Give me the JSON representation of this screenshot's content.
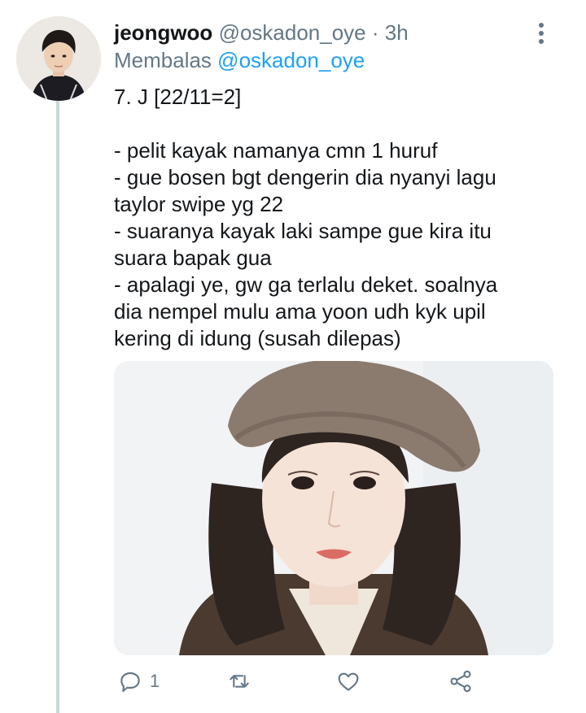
{
  "tweet": {
    "display_name": "jeongwoo",
    "handle": "@oskadon_oye",
    "separator": "·",
    "timestamp": "3h",
    "reply_prefix": "Membalas",
    "reply_to": "@oskadon_oye",
    "lines": [
      "7. J [22/11=2]",
      "",
      "- pelit kayak namanya cmn 1 huruf",
      "- gue bosen bgt dengerin dia nyanyi lagu",
      "taylor swipe yg 22",
      "- suaranya kayak laki sampe gue kira itu",
      "suara bapak gua",
      "- apalagi ye, gw ga terlalu deket. soalnya",
      "dia nempel mulu ama yoon udh kyk upil",
      "kering di idung (susah dilepas)"
    ],
    "reply_count": "1"
  },
  "icons": {
    "more": "more-vertical-icon",
    "reply": "comment-icon",
    "retweet": "retweet-icon",
    "like": "heart-icon",
    "share": "share-icon"
  },
  "colors": {
    "text": "#14171a",
    "muted": "#657786",
    "link": "#1da1f2",
    "thread_line": "#ccd6dd"
  }
}
